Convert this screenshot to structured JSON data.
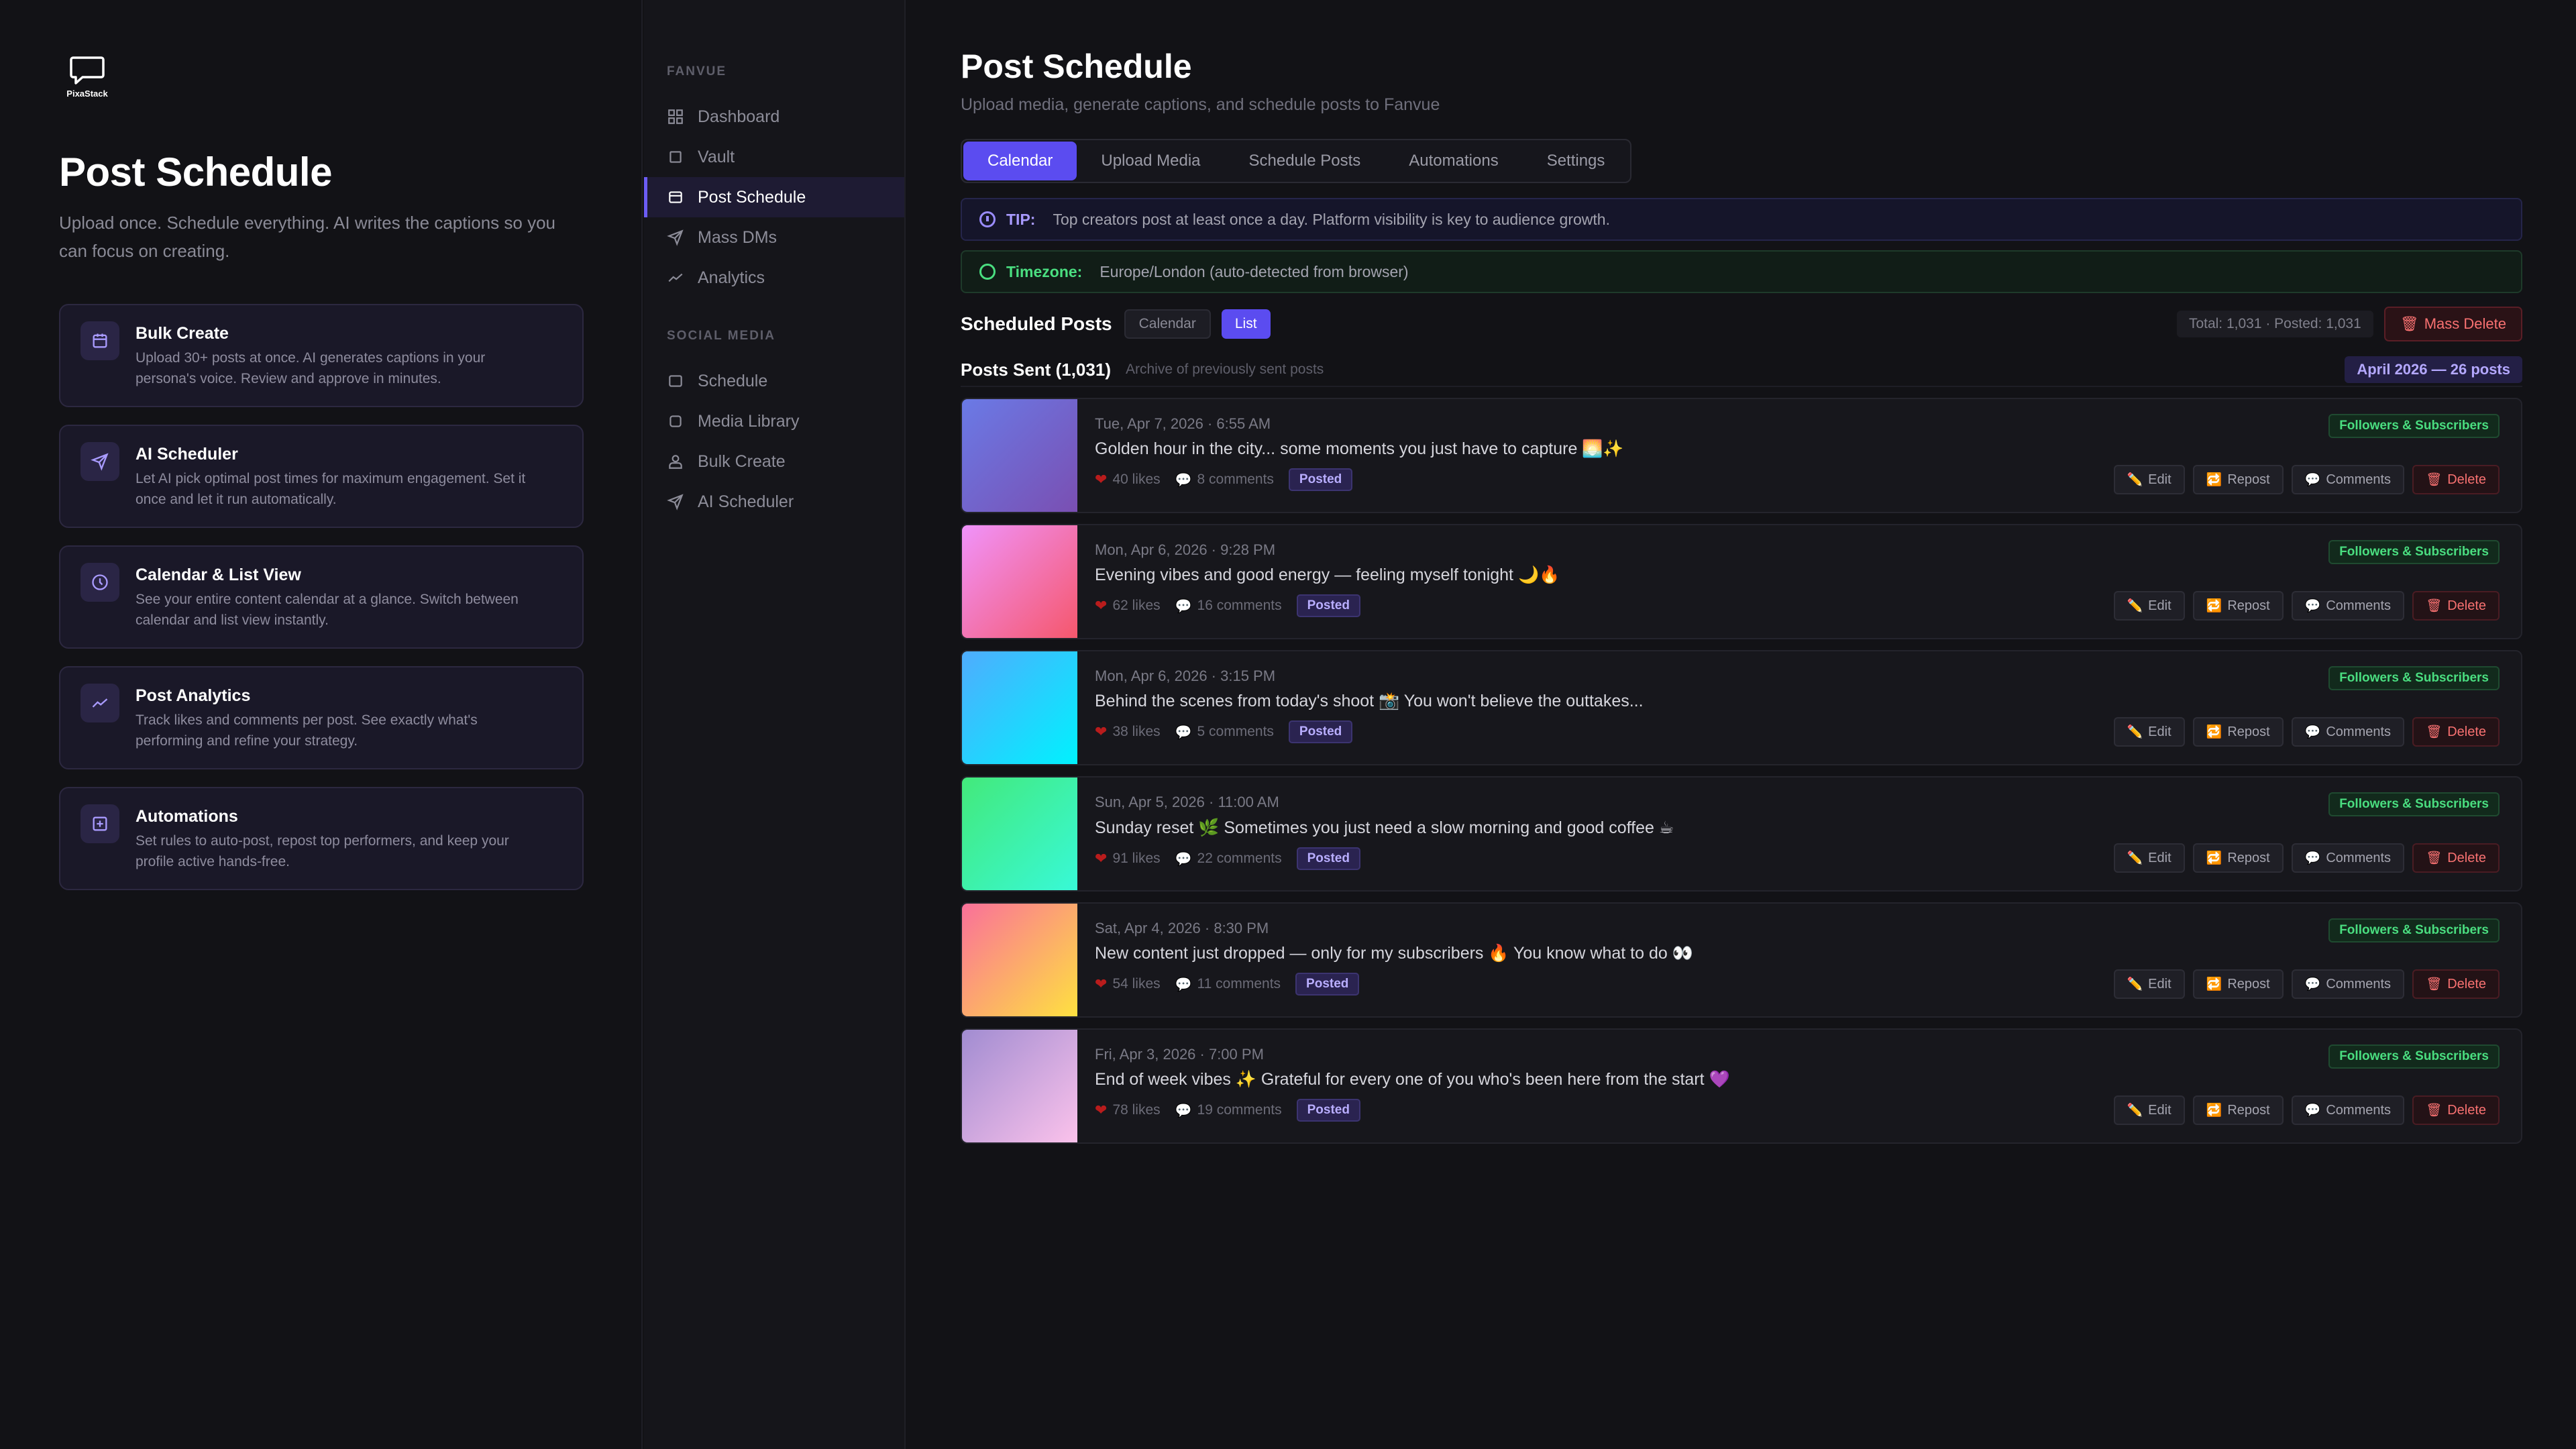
{
  "promo": {
    "logo_text": "PixaStack",
    "title": "Post Schedule",
    "subtitle": "Upload once. Schedule everything. AI writes the captions so you can focus on creating.",
    "features": [
      {
        "icon": "calendar-icon",
        "title": "Bulk Create",
        "desc": "Upload 30+ posts at once. AI generates captions in your persona's voice. Review and approve in minutes."
      },
      {
        "icon": "send-icon",
        "title": "AI Scheduler",
        "desc": "Let AI pick optimal post times for maximum engagement. Set it once and let it run automatically."
      },
      {
        "icon": "clock-icon",
        "title": "Calendar & List View",
        "desc": "See your entire content calendar at a glance. Switch between calendar and list view instantly."
      },
      {
        "icon": "trend-icon",
        "title": "Post Analytics",
        "desc": "Track likes and comments per post. See exactly what's performing and refine your strategy."
      },
      {
        "icon": "plus-box-icon",
        "title": "Automations",
        "desc": "Set rules to auto-post, repost top performers, and keep your profile active hands-free."
      }
    ]
  },
  "sidebar": {
    "section1": "FANVUE",
    "items1": [
      "Dashboard",
      "Vault",
      "Post Schedule",
      "Mass DMs",
      "Analytics"
    ],
    "section2": "SOCIAL MEDIA",
    "items2": [
      "Schedule",
      "Media Library",
      "Bulk Create",
      "AI Scheduler"
    ]
  },
  "main": {
    "title": "Post Schedule",
    "subtitle": "Upload media, generate captions, and schedule posts to Fanvue",
    "tabs": [
      "Calendar",
      "Upload Media",
      "Schedule Posts",
      "Automations",
      "Settings"
    ],
    "tip_label": "TIP:",
    "tip_text": "Top creators post at least once a day. Platform visibility is key to audience growth.",
    "tz_label": "Timezone:",
    "tz_text": "Europe/London (auto-detected from browser)",
    "scheduled_title": "Scheduled Posts",
    "view_calendar": "Calendar",
    "view_list": "List",
    "totals": "Total: 1,031 · Posted: 1,031",
    "mass_delete": "Mass Delete",
    "sent_title": "Posts Sent (1,031)",
    "sent_sub": "Archive of previously sent posts",
    "month_pill": "April 2026 — 26 posts"
  },
  "actions": {
    "edit": "Edit",
    "repost": "Repost",
    "comments": "Comments",
    "delete": "Delete"
  },
  "posts": [
    {
      "date": "Tue, Apr 7, 2026 · 6:55 AM",
      "caption": "Golden hour in the city... some moments you just have to capture 🌅✨",
      "likes": "40 likes",
      "comments": "8 comments",
      "status": "Posted",
      "audience": "Followers & Subscribers",
      "grad_from": "#6a7ae6",
      "grad_to": "#7a4fb2"
    },
    {
      "date": "Mon, Apr 6, 2026 · 9:28 PM",
      "caption": "Evening vibes and good energy — feeling myself tonight 🌙🔥",
      "likes": "62 likes",
      "comments": "16 comments",
      "status": "Posted",
      "audience": "Followers & Subscribers",
      "grad_from": "#f093fb",
      "grad_to": "#f5576c"
    },
    {
      "date": "Mon, Apr 6, 2026 · 3:15 PM",
      "caption": "Behind the scenes from today's shoot 📸 You won't believe the outtakes...",
      "likes": "38 likes",
      "comments": "5 comments",
      "status": "Posted",
      "audience": "Followers & Subscribers",
      "grad_from": "#4facfe",
      "grad_to": "#00f2fe"
    },
    {
      "date": "Sun, Apr 5, 2026 · 11:00 AM",
      "caption": "Sunday reset 🌿 Sometimes you just need a slow morning and good coffee ☕",
      "likes": "91 likes",
      "comments": "22 comments",
      "status": "Posted",
      "audience": "Followers & Subscribers",
      "grad_from": "#43e97b",
      "grad_to": "#38f9d7"
    },
    {
      "date": "Sat, Apr 4, 2026 · 8:30 PM",
      "caption": "New content just dropped — only for my subscribers 🔥 You know what to do 👀",
      "likes": "54 likes",
      "comments": "11 comments",
      "status": "Posted",
      "audience": "Followers & Subscribers",
      "grad_from": "#fa709a",
      "grad_to": "#fee140"
    },
    {
      "date": "Fri, Apr 3, 2026 · 7:00 PM",
      "caption": "End of week vibes ✨ Grateful for every one of you who's been here from the start 💜",
      "likes": "78 likes",
      "comments": "19 comments",
      "status": "Posted",
      "audience": "Followers & Subscribers",
      "grad_from": "#a18cd1",
      "grad_to": "#fbc2eb"
    }
  ]
}
